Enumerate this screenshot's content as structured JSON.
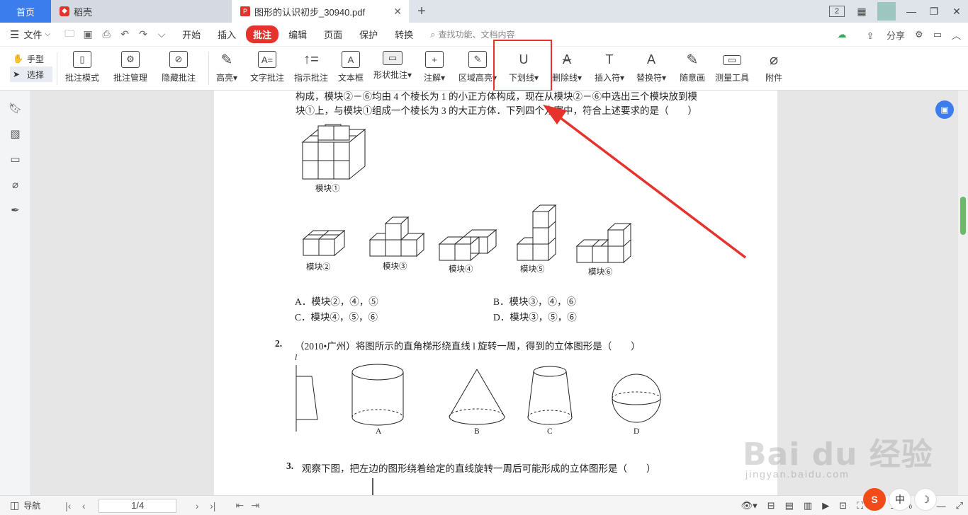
{
  "tabs": {
    "home": "首页",
    "daoke": "稻壳",
    "pdf": "图形的认识初步_30940.pdf",
    "close": "✕",
    "add": "+"
  },
  "window": {
    "badge": "2",
    "min": "—",
    "restore": "❐",
    "close": "✕"
  },
  "menu": {
    "file": "文件",
    "items": [
      "开始",
      "插入",
      "批注",
      "编辑",
      "页面",
      "保护",
      "转换"
    ],
    "active_index": 2,
    "search_placeholder": "查找功能、文档内容",
    "share": "分享"
  },
  "toolbar": {
    "hand": "手型",
    "select": "选择",
    "tools": [
      {
        "label": "批注模式",
        "glyph": "▯"
      },
      {
        "label": "批注管理",
        "glyph": "⚙"
      },
      {
        "label": "隐藏批注",
        "glyph": "⊘"
      },
      {
        "label": "高亮",
        "glyph": "✎"
      },
      {
        "label": "文字批注",
        "glyph": "A="
      },
      {
        "label": "指示批注",
        "glyph": "↑="
      },
      {
        "label": "文本框",
        "glyph": "A"
      },
      {
        "label": "形状批注",
        "glyph": "▭"
      },
      {
        "label": "注解",
        "glyph": "+"
      },
      {
        "label": "区域高亮",
        "glyph": "✎"
      },
      {
        "label": "下划线",
        "glyph": "U"
      },
      {
        "label": "删除线",
        "glyph": "A"
      },
      {
        "label": "插入符",
        "glyph": "T"
      },
      {
        "label": "替换符",
        "glyph": "A"
      },
      {
        "label": "随意画",
        "glyph": "✎"
      },
      {
        "label": "测量工具",
        "glyph": "▭"
      },
      {
        "label": "附件",
        "glyph": "⌀"
      }
    ]
  },
  "document": {
    "q1_line1": "构成，模块②－⑥均由 4 个棱长为 1 的小正方体构成，现在从模块②－⑥中选出三个模块放到模",
    "q1_line2": "块①上，与模块①组成一个棱长为 3 的大正方体．下列四个方案中，符合上述要求的是（　　）",
    "module1": "模块①",
    "module2": "模块②",
    "module3": "模块③",
    "module4": "模块④",
    "module5": "模块⑤",
    "module6": "模块⑥",
    "optA": "A．模块②，④，⑤",
    "optB": "B．模块③，④，⑥",
    "optC": "C．模块④，⑤，⑥",
    "optD": "D．模块③，⑤，⑥",
    "q2_num": "2.",
    "q2_text": "（2010•广州）将图所示的直角梯形绕直线 l 旋转一周，得到的立体图形是（　　）",
    "q2_l": "l",
    "capA": "A",
    "capB": "B",
    "capC": "C",
    "capD": "D",
    "q3_num": "3.",
    "q3_text": "观察下图，把左边的图形绕着给定的直线旋转一周后可能形成的立体图形是（　　）"
  },
  "status": {
    "nav": "导航",
    "page": "1/4",
    "zoom": "100%"
  },
  "ime": {
    "s": "S",
    "zh": "中",
    "moon": "☽"
  },
  "watermark": {
    "main": "Bai du 经验",
    "sub": "jingyan.baidu.com"
  },
  "colors": {
    "accent": "#3b7ded",
    "annotate_red": "#e5322d"
  }
}
